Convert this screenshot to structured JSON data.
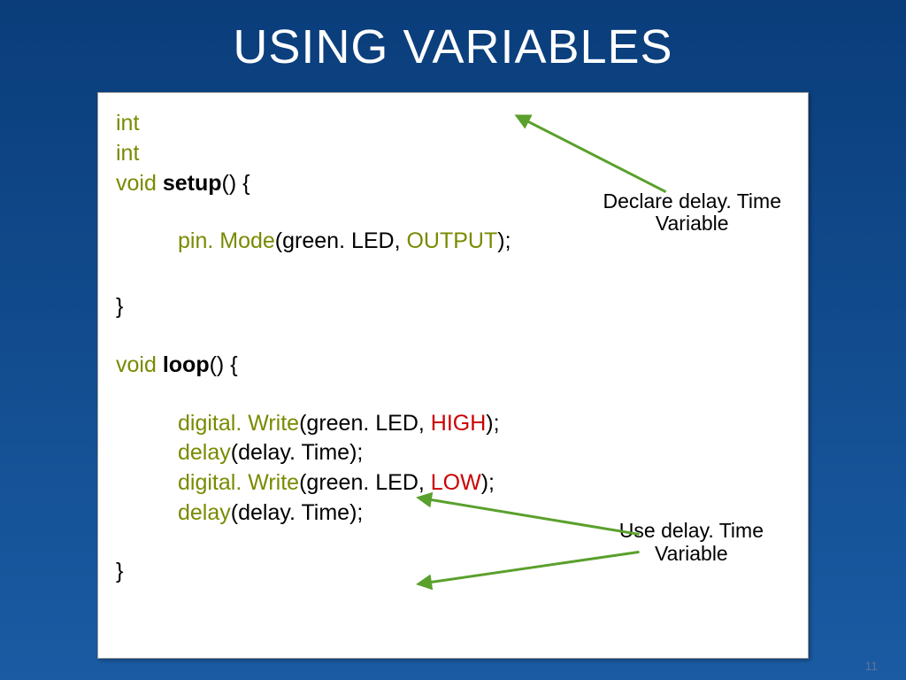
{
  "title": "USING VARIABLES",
  "code": {
    "int1": "int",
    "int2": "int",
    "void": "void",
    "setup": "setup",
    "parens_open": "() {",
    "pinMode": "pin. Mode",
    "greenLED": "(green. LED, ",
    "output": "OUTPUT",
    "close_paren_semi": ");",
    "brace_close1": "}",
    "loop": "loop",
    "digitalWrite": "digital. Write",
    "high": "HIGH",
    "low": "LOW",
    "delay": "delay",
    "delayTime_arg": "(delay. Time);",
    "brace_close2": "}"
  },
  "annotations": {
    "declare": "Declare delay. Time\nVariable",
    "use": "Use delay. Time\nVariable"
  },
  "page_number": "11",
  "colors": {
    "bg_top": "#0a3d7a",
    "bg_bottom": "#1a5ba3",
    "arrow": "#5aa02c"
  }
}
